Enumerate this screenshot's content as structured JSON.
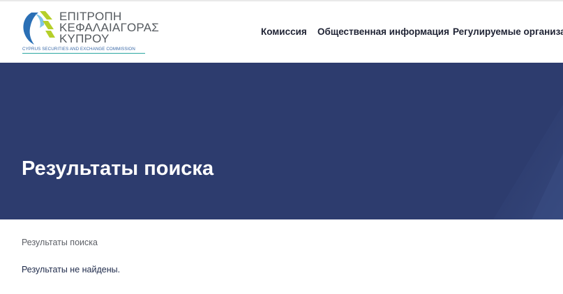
{
  "logo": {
    "line1": "ΕΠΙΤΡΟΠΗ",
    "line2": "ΚΕΦΑΛΑΙΑΓΟΡΑΣ",
    "line3": "ΚΥΠΡΟΥ",
    "subtitle": "CYPRUS SECURITIES AND EXCHANGE COMMISSION",
    "colors": {
      "blue": "#2a6fb5",
      "lime": "#b5cf2a",
      "teal": "#2aa7a0"
    }
  },
  "nav": {
    "items": [
      {
        "label": "Комиссия"
      },
      {
        "label": "Общественная информация"
      },
      {
        "label": "Регулируемые организации"
      }
    ]
  },
  "hero": {
    "title": "Результаты поиска",
    "background": "#2d3c6e"
  },
  "breadcrumb": {
    "current": "Результаты поиска"
  },
  "results": {
    "message": "Результаты не найдены."
  }
}
